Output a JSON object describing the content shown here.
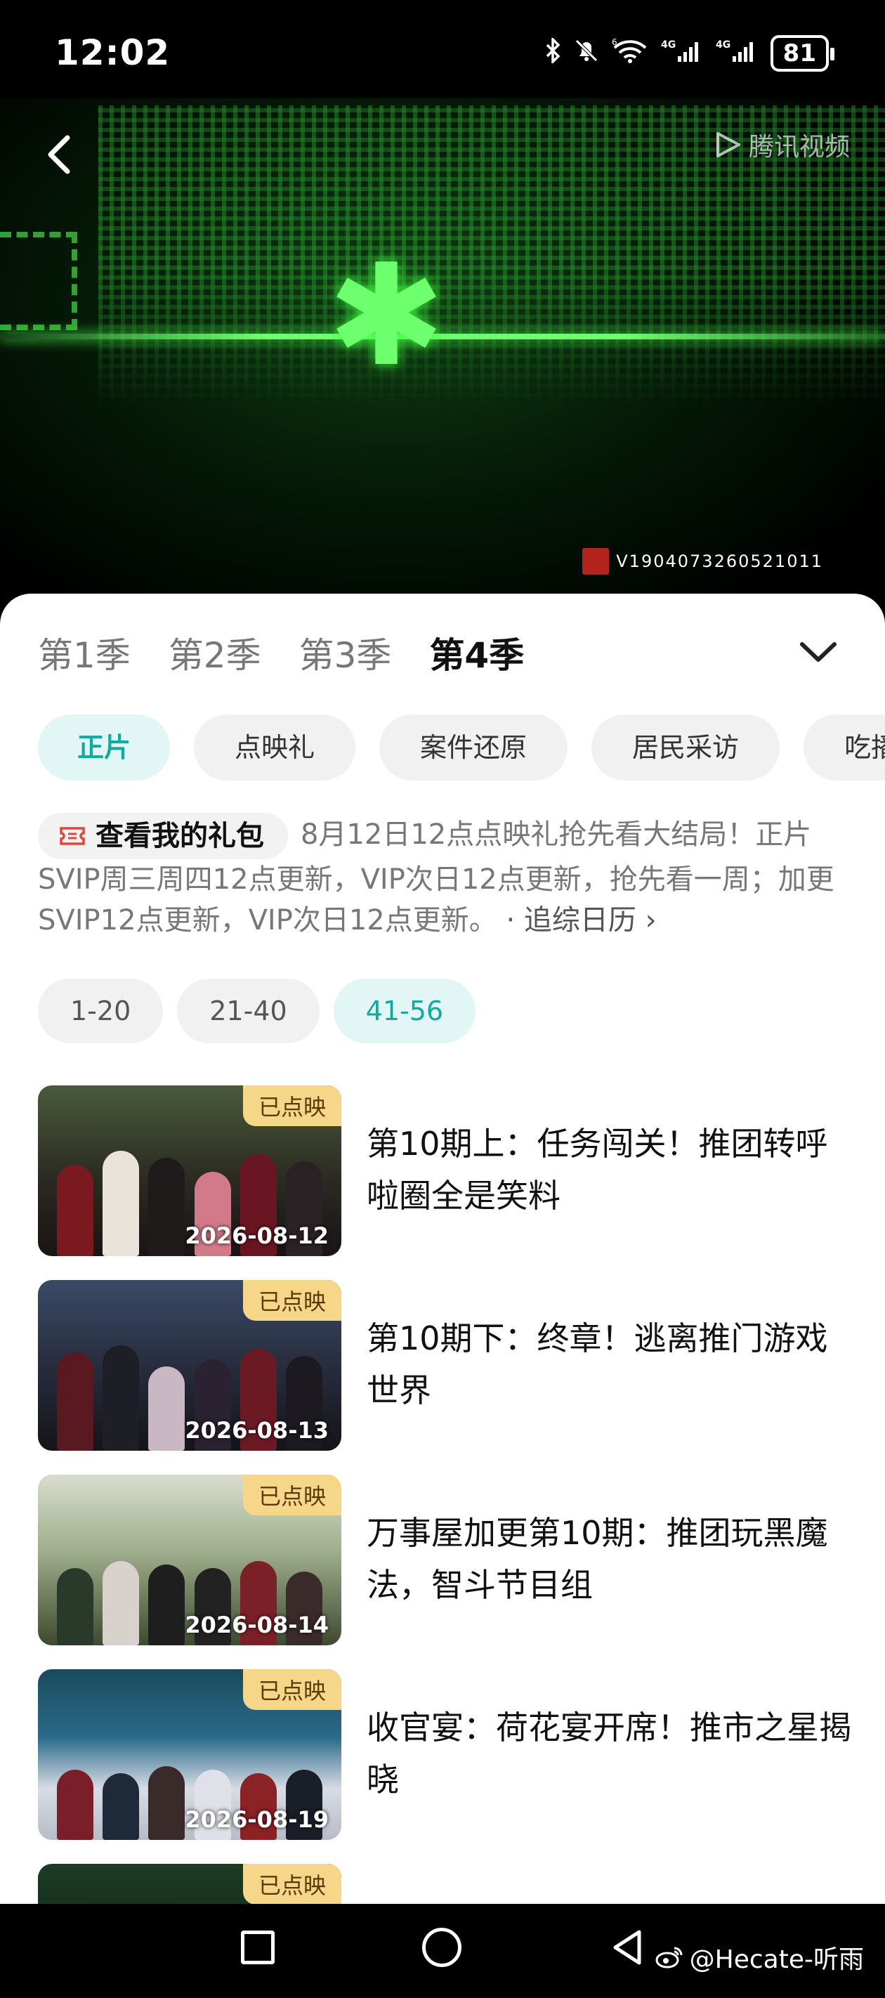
{
  "status_bar": {
    "time": "12:02",
    "network_1": "4G",
    "network_2": "4G",
    "wifi_label": "6",
    "battery": "81"
  },
  "player": {
    "logo_text": "腾讯视频",
    "watermark": "V1904073260521011"
  },
  "seasons": [
    "第1季",
    "第2季",
    "第3季",
    "第4季"
  ],
  "active_season": "第4季",
  "categories": [
    "正片",
    "点映礼",
    "案件还原",
    "居民采访",
    "吃播"
  ],
  "notice": {
    "gift_label": "查看我的礼包",
    "text": "8月12日12点点映礼抢先看大结局！正片SVIP周三周四12点更新，VIP次日12点更新，抢先看一周；加更SVIP12点更新，VIP次日12点更新。",
    "calendar_link": "· 追综日历 ›"
  },
  "ranges": [
    "1-20",
    "21-40",
    "41-56"
  ],
  "episodes": [
    {
      "badge": "已点映",
      "date": "2026-08-12",
      "title": "第10期上：任务闯关！推团转呼啦圈全是笑料"
    },
    {
      "badge": "已点映",
      "date": "2026-08-13",
      "title": "第10期下：终章！逃离推门游戏世界"
    },
    {
      "badge": "已点映",
      "date": "2026-08-14",
      "title": "万事屋加更第10期：推团玩黑魔法，智斗节目组"
    },
    {
      "badge": "已点映",
      "date": "2026-08-19",
      "title": "收官宴：荷花宴开席！推市之星揭晓"
    },
    {
      "badge": "已点映",
      "date": "",
      "title": ""
    }
  ],
  "footer": {
    "weibo_handle": "@Hecate-听雨"
  },
  "colors": {
    "accent": "#12a99f",
    "badge_bg": "#f6d78a",
    "video_green": "#6dff6d"
  }
}
